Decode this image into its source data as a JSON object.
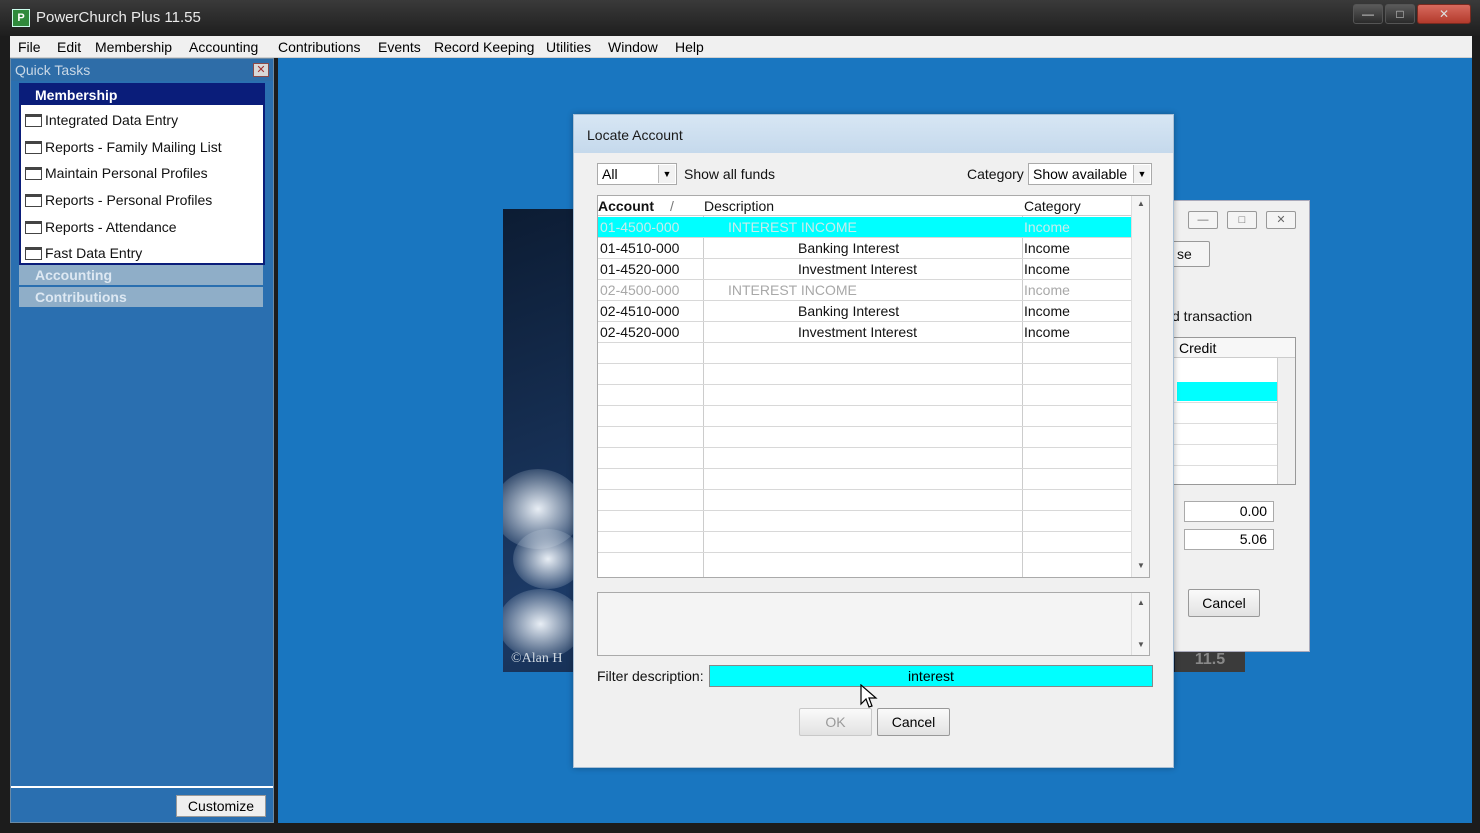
{
  "app": {
    "title": "PowerChurch Plus 11.55"
  },
  "menu": [
    "File",
    "Edit",
    "Membership",
    "Accounting",
    "Contributions",
    "Events",
    "Record Keeping",
    "Utilities",
    "Window",
    "Help"
  ],
  "quick_tasks": {
    "title": "Quick Tasks",
    "membership_header": "Membership",
    "items": [
      "Integrated Data Entry",
      "Reports - Family Mailing List",
      "Maintain Personal Profiles",
      "Reports - Personal Profiles",
      "Reports - Attendance",
      "Fast Data Entry"
    ],
    "groups": [
      "Accounting",
      "Contributions"
    ],
    "customize_label": "Customize"
  },
  "splash": {
    "copyright": "©Alan H",
    "version": "11.5"
  },
  "background_window": {
    "button_partial": "se",
    "transaction_label": "d transaction",
    "credit_header": "Credit",
    "amounts": [
      "0.00",
      "5.06"
    ],
    "cancel_label": "Cancel"
  },
  "dialog": {
    "title": "Locate Account",
    "fund_select": "All",
    "show_all_funds_label": "Show all funds",
    "category_label": "Category",
    "category_select": "Show available",
    "columns": {
      "account": "Account",
      "sort_mark": "/",
      "description": "Description",
      "category": "Category"
    },
    "rows": [
      {
        "account": "01-4500-000",
        "description": "INTEREST INCOME",
        "category": "Income",
        "state": "selected",
        "indent": 1
      },
      {
        "account": "01-4510-000",
        "description": "Banking Interest",
        "category": "Income",
        "state": "normal",
        "indent": 2
      },
      {
        "account": "01-4520-000",
        "description": "Investment Interest",
        "category": "Income",
        "state": "normal",
        "indent": 2
      },
      {
        "account": "02-4500-000",
        "description": "INTEREST INCOME",
        "category": "Income",
        "state": "dim",
        "indent": 1
      },
      {
        "account": "02-4510-000",
        "description": "Banking Interest",
        "category": "Income",
        "state": "normal",
        "indent": 2
      },
      {
        "account": "02-4520-000",
        "description": "Investment Interest",
        "category": "Income",
        "state": "normal",
        "indent": 2
      }
    ],
    "filter_label": "Filter description:",
    "filter_value": "interest",
    "ok_label": "OK",
    "cancel_label": "Cancel"
  }
}
